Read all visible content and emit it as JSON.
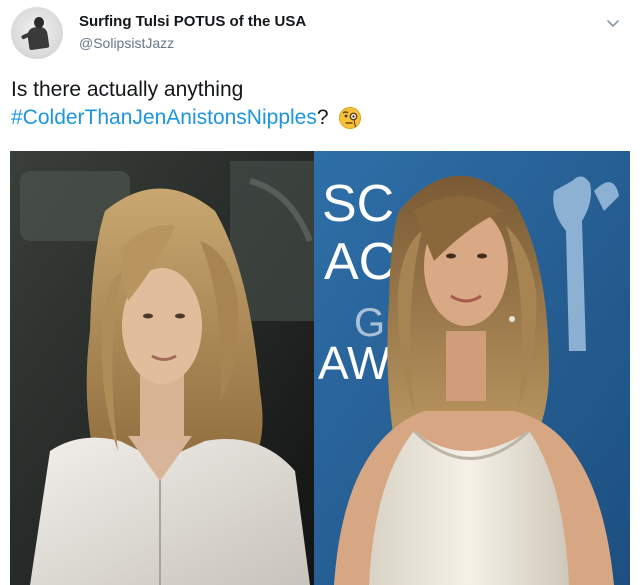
{
  "tweet": {
    "display_name": "Surfing Tulsi POTUS of the USA",
    "handle": "@SolipsistJazz",
    "text_line1": "Is there actually anything",
    "hashtag": "#ColderThanJenAnistonsNipples",
    "text_suffix": "?",
    "emoji": "face-with-monocle",
    "menu_icon": "chevron-down-icon"
  },
  "media": {
    "left_photo": "woman-white-shirt-car-photo",
    "right_photo": "woman-white-dress-red-carpet-photo",
    "backdrop_letters": [
      "SC",
      "AC",
      "G",
      "AWA"
    ]
  }
}
